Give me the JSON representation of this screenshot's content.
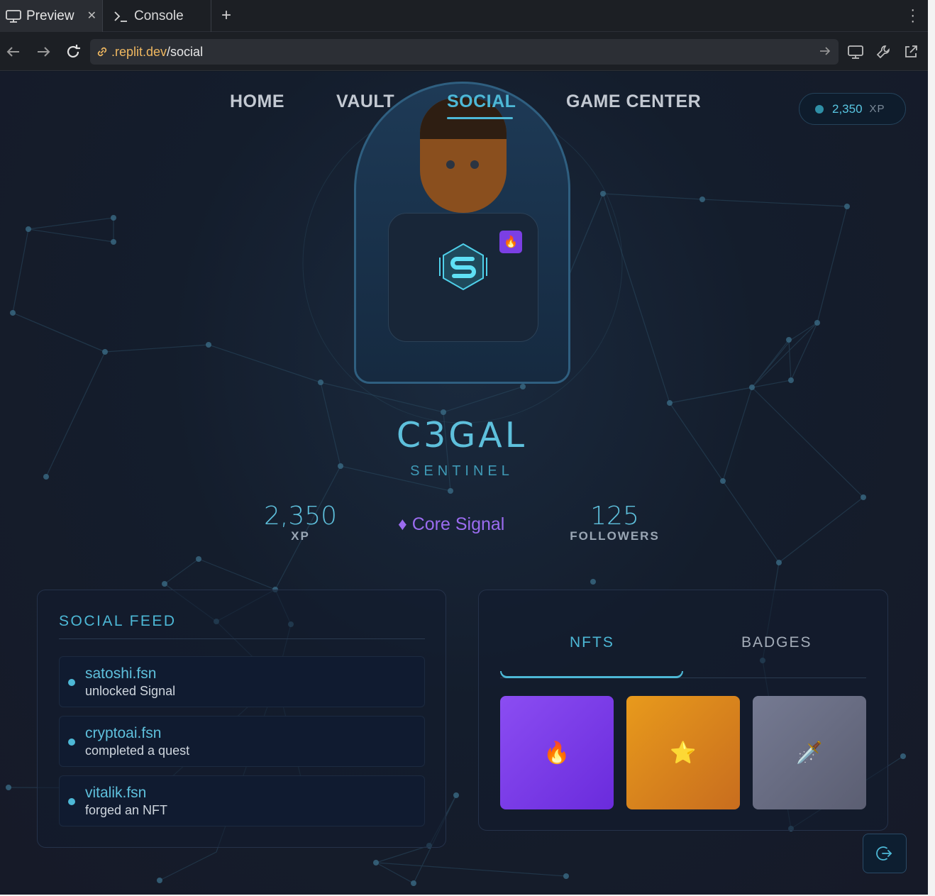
{
  "browser": {
    "tabs": [
      {
        "label": "Preview",
        "icon": "monitor-icon",
        "active": true
      },
      {
        "label": "Console",
        "icon": "terminal-icon",
        "active": false
      }
    ],
    "new_tab": "+",
    "url_host": ".replit.dev",
    "url_path": "/social"
  },
  "nav": {
    "items": [
      "HOME",
      "VAULT",
      "SOCIAL",
      "GAME CENTER"
    ],
    "active": "SOCIAL"
  },
  "xp_pill": {
    "value": "2,350",
    "unit": "XP"
  },
  "profile": {
    "username": "C3GAL",
    "rank": "SENTINEL",
    "xp_value": "2,350",
    "xp_label": "XP",
    "signal": "♦ Core Signal",
    "followers_value": "125",
    "followers_label": "FOLLOWERS"
  },
  "feed": {
    "title": "SOCIAL FEED",
    "items": [
      {
        "user": "satoshi.fsn",
        "action": "unlocked Signal"
      },
      {
        "user": "cryptoai.fsn",
        "action": "completed a quest"
      },
      {
        "user": "vitalik.fsn",
        "action": "forged an NFT"
      }
    ]
  },
  "collection": {
    "tabs": [
      "NFTS",
      "BADGES"
    ],
    "active_tab": "NFTS",
    "nfts": [
      {
        "icon": "fire-icon",
        "glyph": "🔥",
        "color": "#7b3fe4"
      },
      {
        "icon": "star-icon",
        "glyph": "⭐",
        "color": "#e0901c"
      },
      {
        "icon": "dagger-icon",
        "glyph": "🗡️",
        "color": "#6a6d84"
      }
    ]
  },
  "colors": {
    "accent": "#4db8d6",
    "signal": "#9b6cf0",
    "background": "#141d2c"
  }
}
